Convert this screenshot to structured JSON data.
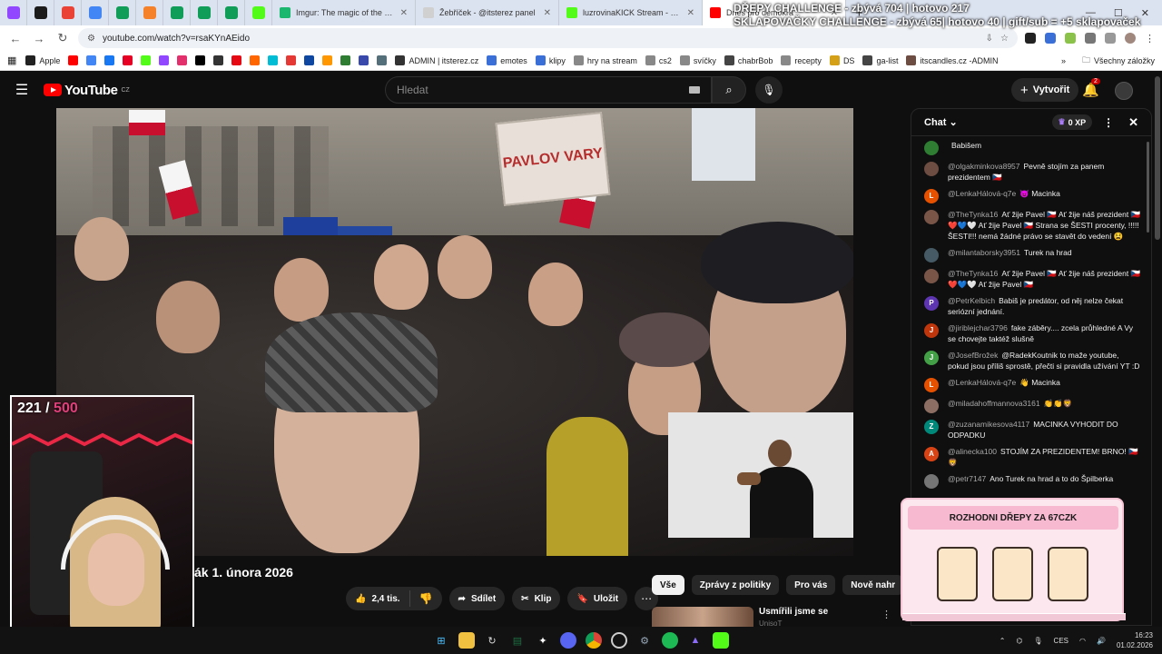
{
  "browser": {
    "tabs_mini": [
      {
        "name": "twitch-tab",
        "color": "#9146ff"
      },
      {
        "name": "kick-tab",
        "color": "#1b1b1b"
      },
      {
        "name": "gmail-tab",
        "color": "#ea4335"
      },
      {
        "name": "docs-tab",
        "color": "#4285f4"
      },
      {
        "name": "sheets-tab",
        "color": "#0f9d58"
      },
      {
        "name": "orange-tab",
        "color": "#f5822a"
      },
      {
        "name": "sheets-tab-2",
        "color": "#0f9d58"
      },
      {
        "name": "sheets-tab-3",
        "color": "#0f9d58"
      },
      {
        "name": "sheets-tab-4",
        "color": "#0f9d58"
      },
      {
        "name": "kick-tab-2",
        "color": "#53fc18"
      }
    ],
    "tabs": [
      {
        "title": "Imgur: The magic of the Interne",
        "color": "#1bb76e",
        "active": false
      },
      {
        "title": "Žebříček - @itsterez panel",
        "color": "#d0d0d0",
        "active": false
      },
      {
        "title": "luzrovinaKICK Stream - Watch L",
        "color": "#53fc18",
        "active": false
      },
      {
        "title": "Dnes pro demokra",
        "color": "#ff0000",
        "active": true
      }
    ],
    "url": "youtube.com/watch?v=rsaKYnAEido",
    "bookmarks": [
      {
        "label": "Apple",
        "color": "#222"
      },
      {
        "label": "",
        "color": "#ff0000"
      },
      {
        "label": "",
        "color": "#4285f4"
      },
      {
        "label": "",
        "color": "#1877f2"
      },
      {
        "label": "",
        "color": "#e60023"
      },
      {
        "label": "",
        "color": "#53fc18"
      },
      {
        "label": "",
        "color": "#9146ff"
      },
      {
        "label": "",
        "color": "#e1306c"
      },
      {
        "label": "",
        "color": "#000"
      },
      {
        "label": "",
        "color": "#333"
      },
      {
        "label": "",
        "color": "#e50914"
      },
      {
        "label": "",
        "color": "#ff6600"
      },
      {
        "label": "",
        "color": "#00bcd4"
      },
      {
        "label": "",
        "color": "#e53935"
      },
      {
        "label": "",
        "color": "#0d47a1"
      },
      {
        "label": "",
        "color": "#ff9800"
      },
      {
        "label": "",
        "color": "#2e7d32"
      },
      {
        "label": "",
        "color": "#3949ab"
      },
      {
        "label": "",
        "color": "#546e7a"
      },
      {
        "label": "ADMIN | itsterez.cz",
        "color": "#333"
      },
      {
        "label": "emotes",
        "color": "#3b6fd8"
      },
      {
        "label": "klipy",
        "color": "#3b6fd8"
      },
      {
        "label": "hry na stream",
        "color": "#888"
      },
      {
        "label": "cs2",
        "color": "#888"
      },
      {
        "label": "svíčky",
        "color": "#888"
      },
      {
        "label": "chabrBob",
        "color": "#444"
      },
      {
        "label": "recepty",
        "color": "#888"
      },
      {
        "label": "DS",
        "color": "#d4a017"
      },
      {
        "label": "ga-list",
        "color": "#444"
      },
      {
        "label": "itscandles.cz -ADMIN",
        "color": "#6d4c41"
      }
    ],
    "bookmarks_more": "»",
    "all_bookmarks": "Všechny záložky"
  },
  "overlay": {
    "line1": "DŘEPY CHALLENGE - zbývá 704 | hotovo 217",
    "line2": "SKLAPOVAČKY CHALLENGE - zbývá 65| hotovo 40 | gift/sub = +5 sklapovaček"
  },
  "youtube": {
    "logo_text": "YouTube",
    "logo_region": "CZ",
    "search_placeholder": "Hledat",
    "create_label": "Vytvořit",
    "notif_count": "2"
  },
  "video": {
    "placard": "PAVLOV VARY",
    "title": "ák 1. února 2026",
    "like_count": "2,4 tis.",
    "share_label": "Sdílet",
    "clip_label": "Klip",
    "save_label": "Uložit"
  },
  "webcam": {
    "counter_current": "221",
    "counter_sep": " / ",
    "counter_max": "500"
  },
  "chips": [
    {
      "label": "Vše",
      "active": true
    },
    {
      "label": "Zprávy z politiky",
      "active": false
    },
    {
      "label": "Pro vás",
      "active": false
    },
    {
      "label": "Nově nahr",
      "active": false
    }
  ],
  "recommendation": {
    "title": "Usmířili jsme se",
    "channel": "UnisoT"
  },
  "chat": {
    "title": "Chat",
    "xp": "0 XP",
    "messages": [
      {
        "author": "",
        "text": "Babišem",
        "avatar_color": "#2e7d32",
        "initial": ""
      },
      {
        "author": "@olgakminkova8957",
        "text": "Pevně stojím za panem prezidentem 🇨🇿",
        "avatar_color": "#6d4c41",
        "initial": ""
      },
      {
        "author": "@LenkaHálová-q7e",
        "text": "😈 Macinka",
        "avatar_color": "#e65100",
        "initial": "L"
      },
      {
        "author": "@TheTynka16",
        "text": "Ať žije Pavel 🇨🇿 Ať žije náš prezident 🇨🇿❤️💙🤍 Ať žije Pavel 🇨🇿 Strana se ŠESTI procenty, !!!!!ŠESTI!!! nemá žádné právo se stavět do vedení 😫",
        "avatar_color": "#795548",
        "initial": ""
      },
      {
        "author": "@milantaborsky3951",
        "text": "Turek na hrad",
        "avatar_color": "#455a64",
        "initial": ""
      },
      {
        "author": "@TheTynka16",
        "text": "Ať žije Pavel 🇨🇿 Ať žije náš prezident 🇨🇿❤️💙🤍 Ať žije Pavel 🇨🇿",
        "avatar_color": "#795548",
        "initial": ""
      },
      {
        "author": "@PetrKelbich",
        "text": "Babiš je predátor, od něj nelze čekat seriózní jednání.",
        "avatar_color": "#5e35b1",
        "initial": "P"
      },
      {
        "author": "@jiriblejchar3796",
        "text": "fake záběry.... zcela průhledné A Vy se chovejte taktéž slušně",
        "avatar_color": "#bf360c",
        "initial": "J"
      },
      {
        "author": "@JosefBrožek",
        "text": "@RadekKoutnik to maže youtube, pokud jsou příliš sprostě, přečti si pravidla užívání YT :D",
        "avatar_color": "#43a047",
        "initial": "J"
      },
      {
        "author": "@LenkaHálová-q7e",
        "text": "👋 Macinka",
        "avatar_color": "#e65100",
        "initial": "L"
      },
      {
        "author": "@miladahoffmannova3161",
        "text": "👏👏🦁",
        "avatar_color": "#8d6e63",
        "initial": ""
      },
      {
        "author": "@zuzanamikesova4117",
        "text": "MACINKA VYHODIT DO ODPADKU",
        "avatar_color": "#00897b",
        "initial": "Z"
      },
      {
        "author": "@alinecka100",
        "text": "STOJÍM ZA PREZIDENTEM! BRNO! 🇨🇿🦁",
        "avatar_color": "#d84315",
        "initial": "A"
      },
      {
        "author": "@petr7147",
        "text": "Ano Turek na hrad a to do Špilberka",
        "avatar_color": "#757575",
        "initial": ""
      }
    ]
  },
  "drepy": {
    "title": "ROZHODNI DŘEPY ZA 67CZK"
  },
  "taskbar": {
    "lang": "CES",
    "time": "16:23",
    "date": "01.02.2026"
  },
  "colors": {
    "yt_red": "#ff0000",
    "accent_pink": "#f7b9cf"
  }
}
